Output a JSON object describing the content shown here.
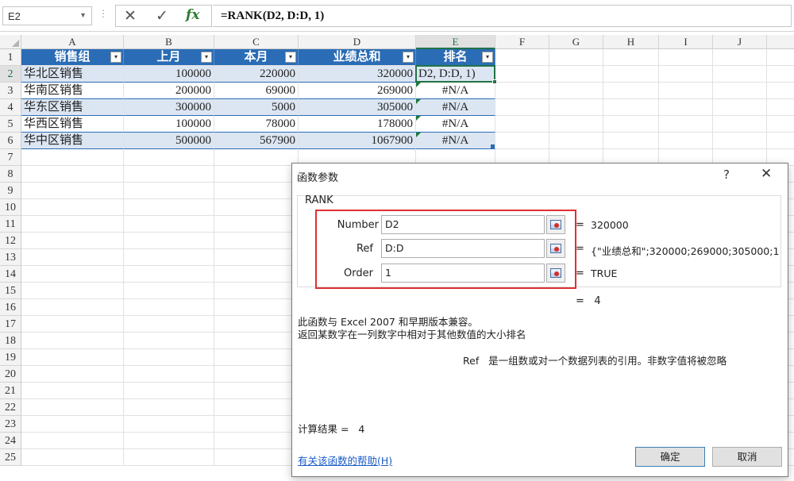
{
  "formula_bar": {
    "name_box": "E2",
    "formula": "=RANK(D2, D:D, 1)",
    "fx_label": "fx"
  },
  "columns": [
    "A",
    "B",
    "C",
    "D",
    "E",
    "F",
    "G",
    "H",
    "I",
    "J"
  ],
  "rows": [
    "1",
    "2",
    "3",
    "4",
    "5",
    "6",
    "7",
    "8",
    "9",
    "10",
    "11",
    "12",
    "13",
    "14",
    "15",
    "16",
    "17",
    "18",
    "19",
    "20",
    "21",
    "22",
    "23",
    "24",
    "25"
  ],
  "table": {
    "headers": [
      "销售组",
      "上月",
      "本月",
      "业绩总和",
      "排名"
    ],
    "data": [
      [
        "华北区销售",
        "100000",
        "220000",
        "320000",
        "D2, D:D, 1)"
      ],
      [
        "华南区销售",
        "200000",
        "69000",
        "269000",
        "#N/A"
      ],
      [
        "华东区销售",
        "300000",
        "5000",
        "305000",
        "#N/A"
      ],
      [
        "华西区销售",
        "100000",
        "78000",
        "178000",
        "#N/A"
      ],
      [
        "华中区销售",
        "500000",
        "567900",
        "1067900",
        "#N/A"
      ]
    ]
  },
  "dialog": {
    "title": "函数参数",
    "help": "?",
    "close": "✕",
    "function_name": "RANK",
    "args": [
      {
        "label": "Number",
        "value": "D2",
        "result": "320000"
      },
      {
        "label": "Ref",
        "value": "D:D",
        "result": "{\"业绩总和\";320000;269000;305000;1"
      },
      {
        "label": "Order",
        "value": "1",
        "result": "TRUE"
      }
    ],
    "equals": "=",
    "formula_result": "4",
    "compat_note": "此函数与 Excel 2007 和早期版本兼容。",
    "description": "返回某数字在一列数字中相对于其他数值的大小排名",
    "ref_help": "Ref   是一组数或对一个数据列表的引用。非数字值将被忽略",
    "calc_result_label": "计算结果 =   4",
    "help_link": "有关该函数的帮助(H)",
    "ok": "确定",
    "cancel": "取消"
  },
  "colors": {
    "table_header": "#2a6cb5",
    "band": "#dce6f2",
    "selection": "#217346",
    "highlight_box": "#e03030"
  }
}
